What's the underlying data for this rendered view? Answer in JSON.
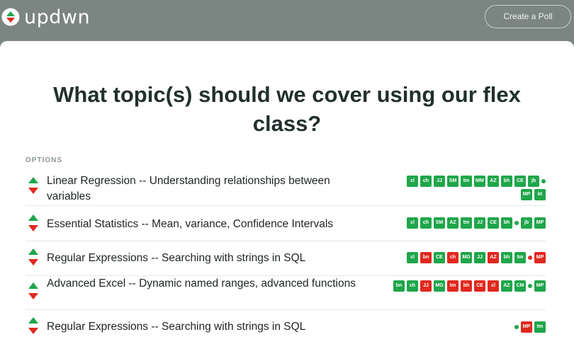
{
  "app": {
    "name": "updwn",
    "create_label": "Create a Poll"
  },
  "poll": {
    "title": "What topic(s) should we cover using our flex class?",
    "options_label": "OPTIONS"
  },
  "options": [
    {
      "text": "Linear Regression -- Understanding relationships between variables",
      "badges": [
        {
          "t": "cl",
          "c": "g"
        },
        {
          "t": "ch",
          "c": "g"
        },
        {
          "t": "JJ",
          "c": "g"
        },
        {
          "t": "SM",
          "c": "g"
        },
        {
          "t": "tm",
          "c": "g"
        },
        {
          "t": "MM",
          "c": "g"
        },
        {
          "t": "AZ",
          "c": "g"
        },
        {
          "t": "bh",
          "c": "g"
        },
        {
          "t": "CE",
          "c": "g"
        },
        {
          "t": "jb",
          "c": "g"
        },
        {
          "t": "",
          "c": "g",
          "dot": true
        },
        {
          "t": "MP",
          "c": "g"
        },
        {
          "t": "kt",
          "c": "g"
        }
      ]
    },
    {
      "text": "Essential Statistics -- Mean, variance, Confidence Intervals",
      "badges": [
        {
          "t": "cl",
          "c": "g"
        },
        {
          "t": "ch",
          "c": "g"
        },
        {
          "t": "SM",
          "c": "g"
        },
        {
          "t": "AZ",
          "c": "g"
        },
        {
          "t": "tm",
          "c": "g"
        },
        {
          "t": "JJ",
          "c": "g"
        },
        {
          "t": "CE",
          "c": "g"
        },
        {
          "t": "bh",
          "c": "g"
        },
        {
          "t": "",
          "c": "g",
          "dot": true
        },
        {
          "t": "jb",
          "c": "g"
        },
        {
          "t": "MP",
          "c": "g"
        }
      ]
    },
    {
      "text": "Regular Expressions -- Searching with strings in SQL",
      "badges": [
        {
          "t": "cl",
          "c": "g"
        },
        {
          "t": "bn",
          "c": "r"
        },
        {
          "t": "CE",
          "c": "g"
        },
        {
          "t": "ch",
          "c": "r"
        },
        {
          "t": "MG",
          "c": "g"
        },
        {
          "t": "JJ",
          "c": "g"
        },
        {
          "t": "AZ",
          "c": "r"
        },
        {
          "t": "bh",
          "c": "g"
        },
        {
          "t": "tm",
          "c": "g"
        },
        {
          "t": "",
          "c": "r",
          "dot": true
        },
        {
          "t": "MP",
          "c": "r"
        }
      ]
    },
    {
      "text": "Advanced Excel -- Dynamic named ranges, advanced functions",
      "badges": [
        {
          "t": "bn",
          "c": "g"
        },
        {
          "t": "ch",
          "c": "g"
        },
        {
          "t": "JJ",
          "c": "r"
        },
        {
          "t": "MG",
          "c": "g"
        },
        {
          "t": "tm",
          "c": "r"
        },
        {
          "t": "bh",
          "c": "r"
        },
        {
          "t": "CE",
          "c": "r"
        },
        {
          "t": "cl",
          "c": "r"
        },
        {
          "t": "AZ",
          "c": "g"
        },
        {
          "t": "CM",
          "c": "g"
        },
        {
          "t": "",
          "c": "g",
          "dot": true
        },
        {
          "t": "MP",
          "c": "g"
        }
      ]
    },
    {
      "text": "Regular Expressions -- Searching with strings in SQL",
      "badges": [
        {
          "t": "",
          "c": "g",
          "dot": true
        },
        {
          "t": "MP",
          "c": "r"
        },
        {
          "t": "tm",
          "c": "g"
        }
      ]
    }
  ],
  "colors": {
    "green": "#1fa64a",
    "red": "#e0281f",
    "header": "#7b8582"
  }
}
